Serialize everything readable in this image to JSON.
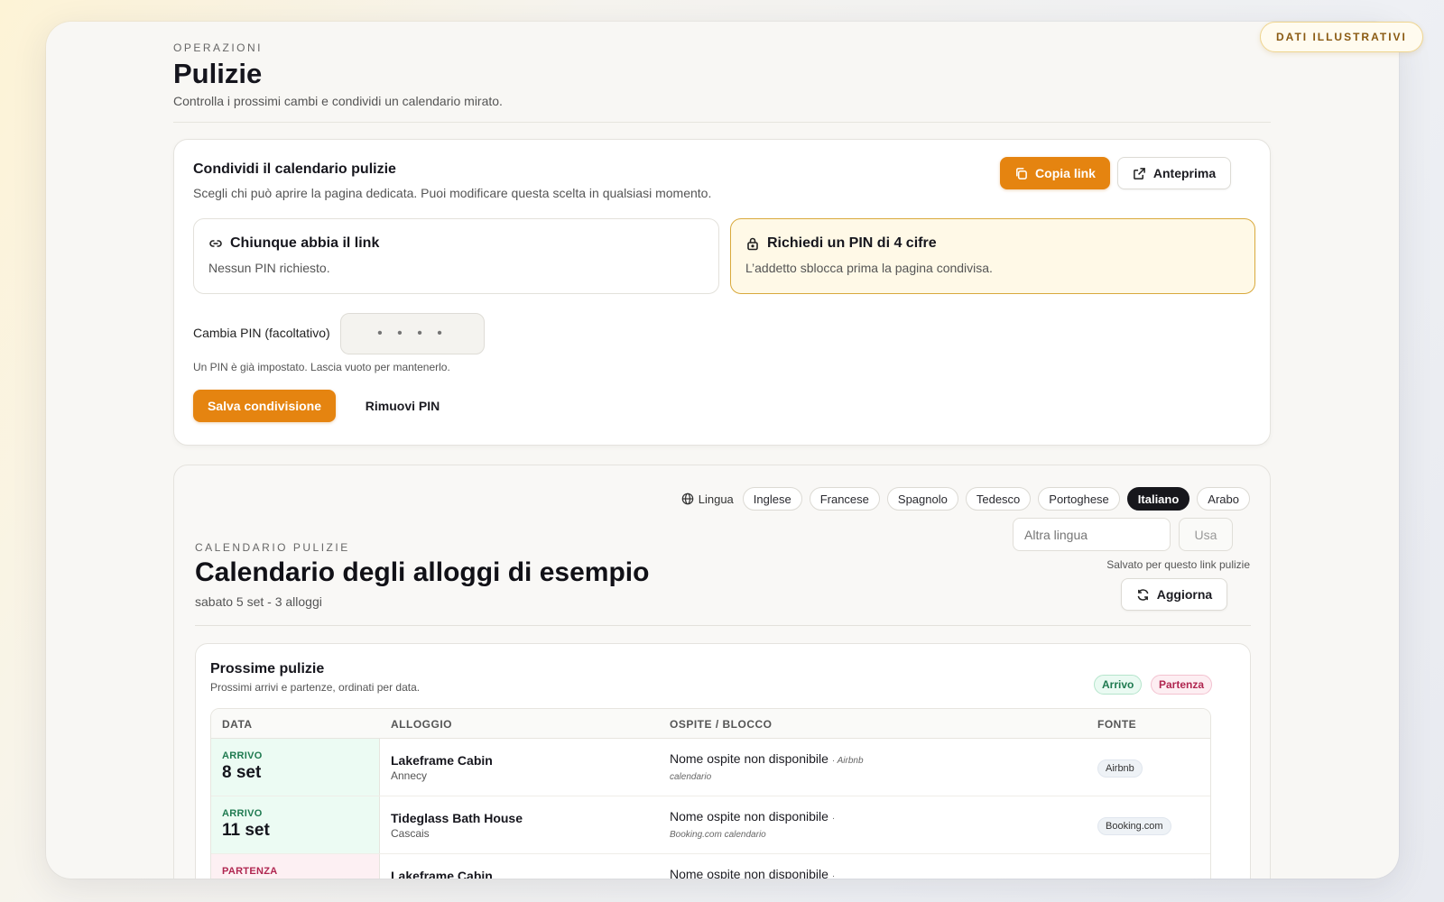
{
  "badge": "DATI ILLUSTRATIVI",
  "header": {
    "eyebrow": "OPERAZIONI",
    "title": "Pulizie",
    "subtitle": "Controlla i prossimi cambi e condividi un calendario mirato."
  },
  "share": {
    "title": "Condividi il calendario pulizie",
    "subtitle": "Scegli chi può aprire la pagina dedicata. Puoi modificare questa scelta in qualsiasi momento.",
    "copy_link": "Copia link",
    "preview": "Anteprima",
    "option_link_title": "Chiunque abbia il link",
    "option_link_desc": "Nessun PIN richiesto.",
    "option_pin_title": "Richiedi un PIN di 4 cifre",
    "option_pin_desc": "L’addetto sblocca prima la pagina condivisa.",
    "pin_label": "Cambia PIN (facoltativo)",
    "pin_placeholder": "• • • •",
    "pin_hint": "Un PIN è già impostato. Lascia vuoto per mantenerlo.",
    "save": "Salva condivisione",
    "remove_pin": "Rimuovi PIN",
    "accent": "#e58410"
  },
  "calendar": {
    "language_label": "Lingua",
    "languages": [
      "Inglese",
      "Francese",
      "Spagnolo",
      "Tedesco",
      "Portoghese",
      "Italiano",
      "Arabo"
    ],
    "active_language": "Italiano",
    "other_language_placeholder": "Altra lingua",
    "use": "Usa",
    "saved_note": "Salvato per questo link pulizie",
    "refresh": "Aggiorna",
    "eyebrow": "CALENDARIO PULIZIE",
    "title": "Calendario degli alloggi di esempio",
    "subtitle": "sabato 5 set - 3 alloggi"
  },
  "upcoming": {
    "title": "Prossime pulizie",
    "subtitle": "Prossimi arrivi e partenze, ordinati per data.",
    "tag_arrival": "Arrivo",
    "tag_departure": "Partenza",
    "columns": [
      "DATA",
      "ALLOGGIO",
      "OSPITE / BLOCCO",
      "FONTE"
    ],
    "rows": [
      {
        "event": "ARRIVO",
        "type": "arr",
        "date": "8 set",
        "property": "Lakeframe Cabin",
        "location": "Annecy",
        "guest": "Nome ospite non disponibile",
        "guest_src_a": "· Airbnb",
        "guest_src_b": "calendario",
        "source": "Airbnb"
      },
      {
        "event": "ARRIVO",
        "type": "arr",
        "date": "11 set",
        "property": "Tideglass Bath House",
        "location": "Cascais",
        "guest": "Nome ospite non disponibile",
        "guest_src_a": "·",
        "guest_src_b": "Booking.com calendario",
        "source": "Booking.com"
      },
      {
        "event": "PARTENZA",
        "type": "dep",
        "date": "",
        "property": "Lakeframe Cabin",
        "location": "",
        "guest": "Nome ospite non disponibile",
        "guest_src_a": "·",
        "guest_src_b": "",
        "source": ""
      }
    ]
  }
}
